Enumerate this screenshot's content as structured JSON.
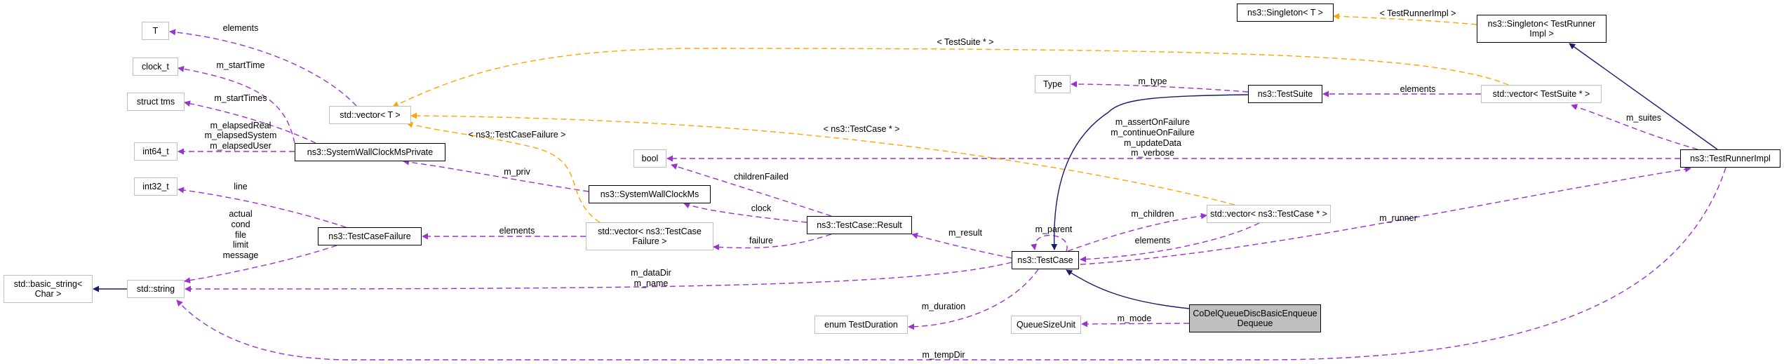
{
  "title": "CoDelQueueDiscBasicEnqueueDequeue collaboration diagram",
  "colors": {
    "member": "#9a32cd",
    "template": "#ffa500",
    "inheritance": "#191970",
    "focus_fill": "#bfbfbf",
    "external_border": "#bfbfbf",
    "documented_border": "#000000"
  },
  "nodes": {
    "T": "T",
    "clock_t": "clock_t",
    "struct_tms": "struct tms",
    "int64_t": "int64_t",
    "int32_t": "int32_t",
    "basic_string": "std::basic_string<\nChar >",
    "std_string": "std::string",
    "vector_T": "std::vector< T >",
    "swcm_private": "ns3::SystemWallClockMsPrivate",
    "test_case_failure": "ns3::TestCaseFailure",
    "vector_tcf": "std::vector< ns3::TestCase\nFailure >",
    "bool": "bool",
    "swcm": "ns3::SystemWallClockMs",
    "tc_result": "ns3::TestCase::Result",
    "enum_duration": "enum TestDuration",
    "test_case": "ns3::TestCase",
    "queue_size_unit": "QueueSizeUnit",
    "codel": "CoDelQueueDiscBasicEnqueue\nDequeue",
    "type": "Type",
    "test_suite": "ns3::TestSuite",
    "vector_tc": "std::vector< ns3::TestCase * >",
    "singleton_T": "ns3::Singleton< T >",
    "singleton_tri": "ns3::Singleton< TestRunner\nImpl >",
    "vector_ts": "std::vector< TestSuite * >",
    "test_runner_impl": "ns3::TestRunnerImpl"
  },
  "edge_labels": {
    "elements_T": "elements",
    "m_startTime": "m_startTime",
    "m_startTimes": "m_startTimes",
    "m_elapsed": [
      "m_elapsedReal",
      "m_elapsedSystem",
      "m_elapsedUser"
    ],
    "line": "line",
    "failure_fields": [
      "actual",
      "cond",
      "file",
      "limit",
      "message"
    ],
    "tpl_testcasefailure": "< ns3::TestCaseFailure >",
    "m_priv": "m_priv",
    "elements_tcf": "elements",
    "tpl_testsuite": "< TestSuite * >",
    "tpl_testcase": "< ns3::TestCase * >",
    "childrenFailed": "childrenFailed",
    "clock": "clock",
    "failure": "failure",
    "m_dataDir_name": [
      "m_dataDir",
      "m_name"
    ],
    "m_result": "m_result",
    "m_parent": "m_parent",
    "m_children": "m_children",
    "elements_tc": "elements",
    "m_duration": "m_duration",
    "m_mode": "m_mode",
    "m_tempDir": "m_tempDir",
    "m_type": "m_type",
    "bool_flags": [
      "m_assertOnFailure",
      "m_continueOnFailure",
      "m_updateData",
      "m_verbose"
    ],
    "tpl_testrunnerimpl": "< TestRunnerImpl >",
    "elements_ts": "elements",
    "m_suites": "m_suites",
    "m_runner": "m_runner"
  }
}
